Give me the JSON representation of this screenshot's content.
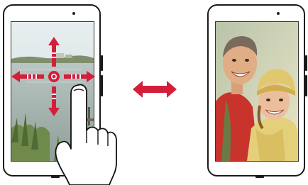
{
  "left_device": {
    "screen_scene": "landscape-with-water",
    "gesture": "pinch-pan-arrows"
  },
  "right_device": {
    "screen_scene": "couple-photo"
  },
  "colors": {
    "arrow_red": "#d41f3b",
    "frame": "#1a1a1a",
    "sky_top": "#dfe9ea",
    "water": "#a8b7b4",
    "grass": "#6f8a4a"
  },
  "icons": {
    "move_arrows": "four-way-arrow-icon",
    "transition": "double-arrow-icon",
    "hand": "pointing-hand-icon"
  }
}
